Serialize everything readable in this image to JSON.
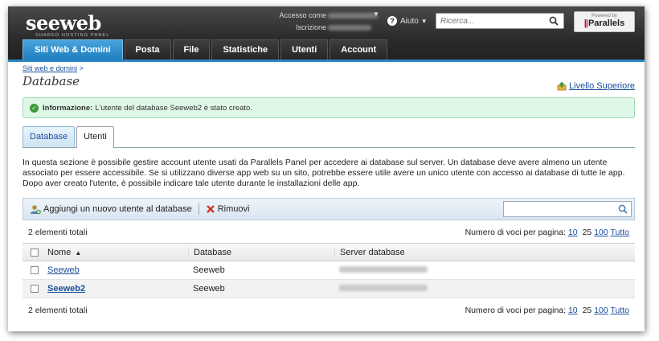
{
  "header": {
    "logo_text": "seeweb",
    "logo_tagline": "SHARED HOSTING PANEL",
    "account_label": "Accesso come",
    "subscription_label": "Iscrizione",
    "help_label": "Aiuto",
    "search_placeholder": "Ricerca...",
    "powered_by": "Powered by",
    "parallels_name": "Parallels"
  },
  "nav": {
    "tabs": [
      {
        "label": "Siti Web & Domini",
        "active": true
      },
      {
        "label": "Posta"
      },
      {
        "label": "File"
      },
      {
        "label": "Statistiche"
      },
      {
        "label": "Utenti"
      },
      {
        "label": "Account"
      }
    ]
  },
  "page": {
    "breadcrumb": "Siti web e domini",
    "breadcrumb_sep": ">",
    "title": "Database",
    "up_level": "Livello Superiore",
    "message_label": "Informazione:",
    "message_text": "L'utente del database Seeweb2 è stato creato.",
    "subtabs": [
      {
        "label": "Database"
      },
      {
        "label": "Utenti",
        "active": true
      }
    ],
    "description": "In questa sezione è possibile gestire account utente usati da Parallels Panel per accedere ai database sul server. Un database deve avere almeno un utente associato per essere accessibile. Se si utilizzano diverse app web su un sito, potrebbe essere utile avere un unico utente con accesso ai database di tutte le app. Dopo aver creato l'utente, è possibile indicare tale utente durante le installazioni delle app."
  },
  "toolbar": {
    "add_label": "Aggiungi un nuovo utente al database",
    "remove_label": "Rimuovi"
  },
  "list": {
    "total_label": "2 elementi totali",
    "per_page_label": "Numero di voci per pagina:",
    "per_page_options": [
      "10",
      "25",
      "100",
      "Tutto"
    ],
    "columns": {
      "name": "Nome",
      "sort_indicator": "▲",
      "database": "Database",
      "server": "Server database"
    },
    "rows": [
      {
        "name": "Seeweb",
        "database": "Seeweb"
      },
      {
        "name": "Seeweb2",
        "database": "Seeweb"
      }
    ]
  },
  "colors": {
    "accent_blue": "#2b86c5",
    "link_blue": "#1a4f9c",
    "success_bg": "#dff7e6"
  }
}
